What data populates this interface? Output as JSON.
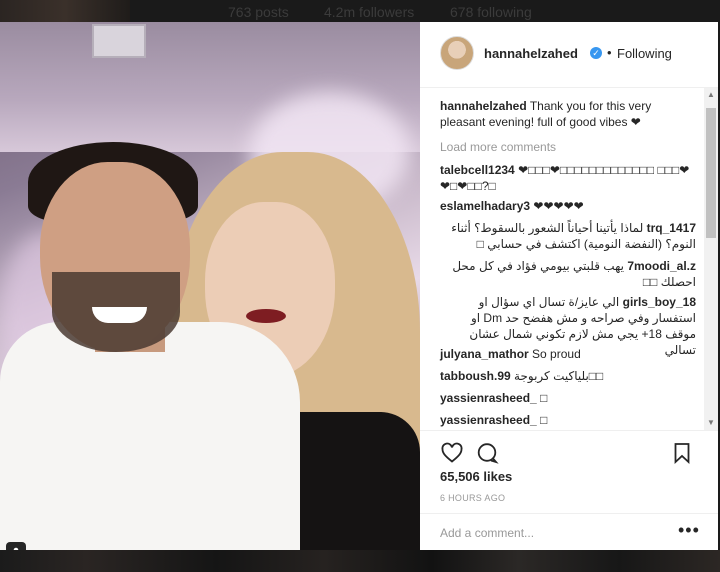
{
  "profile_stats": {
    "posts": "763 posts",
    "followers": "4.2m followers",
    "following": "678 following"
  },
  "post": {
    "username": "hannahelzahed",
    "verified": true,
    "follow_separator": "•",
    "follow_state": "Following",
    "caption_user": "hannahelzahed",
    "caption_text": "Thank you for this very pleasant evening! full of good vibes ❤",
    "load_more": "Load more comments",
    "comments": [
      {
        "user": "talebcell1234",
        "text": "❤□□□❤□□□□□□□□□□□□□ □□□❤❤□❤□□?□"
      },
      {
        "user": "eslamelhadary3",
        "text": "❤❤❤❤❤"
      },
      {
        "user": "trq_1417",
        "text": "لماذا يأتينا أحياناً الشعور بالسقوط؟ أثناء النوم؟ (النفضة النومية) اكتشف في حسابي □"
      },
      {
        "user": "7moodi_al.z",
        "text": "يهب قلبتي بيومي فؤاد في كل محل احصلك □□"
      },
      {
        "user": "girls_boy_18",
        "text": "الي عايز/ة تسال اي سؤال او استفسار وفي صراحه و مش هفضح حد Dm او موقف 18+ يجي مش لازم تكوني شمال عشان تسالي"
      },
      {
        "user": "julyana_mathor",
        "text": "So proud"
      },
      {
        "user": "tabboush.99",
        "text": "بلياكيت كربوجة□□"
      },
      {
        "user": "yassienrasheed_",
        "text": "□"
      },
      {
        "user": "yassienrasheed_",
        "text": "□"
      }
    ],
    "likes": "65,506 likes",
    "time_ago": "6 HOURS AGO",
    "add_comment_placeholder": "Add a comment...",
    "more_options": "•••"
  },
  "icons": {
    "like": "heart-icon",
    "comment": "comment-icon",
    "save": "bookmark-icon",
    "tag": "user-tag-icon",
    "verified": "verified-badge-icon"
  },
  "colors": {
    "verified_blue": "#3897f0",
    "text": "#262626",
    "muted": "#999999"
  }
}
